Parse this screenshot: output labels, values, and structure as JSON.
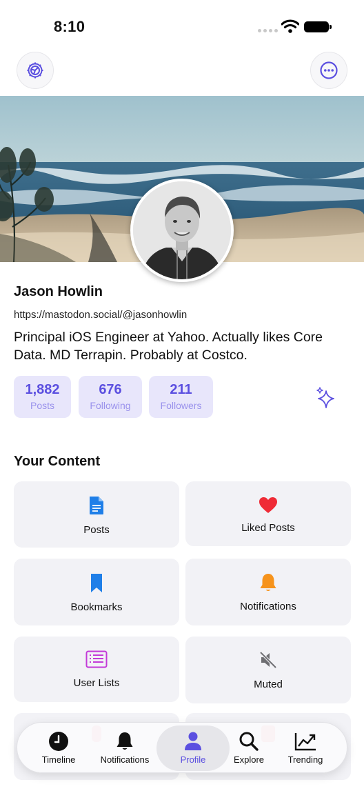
{
  "status": {
    "time": "8:10"
  },
  "profile": {
    "name": "Jason Howlin",
    "handle": "https://mastodon.social/@jasonhowlin",
    "bio": "Principal iOS Engineer at Yahoo. Actually likes Core Data. MD Terrapin. Probably at Costco."
  },
  "stats": [
    {
      "value": "1,882",
      "label": "Posts"
    },
    {
      "value": "676",
      "label": "Following"
    },
    {
      "value": "211",
      "label": "Followers"
    }
  ],
  "content": {
    "title": "Your Content",
    "tiles": [
      {
        "label": "Posts",
        "icon": "document-icon"
      },
      {
        "label": "Liked Posts",
        "icon": "heart-icon"
      },
      {
        "label": "Bookmarks",
        "icon": "bookmark-icon"
      },
      {
        "label": "Notifications",
        "icon": "bell-icon"
      },
      {
        "label": "User Lists",
        "icon": "list-icon"
      },
      {
        "label": "Muted",
        "icon": "speaker-mute-icon"
      }
    ]
  },
  "tabbar": {
    "items": [
      {
        "label": "Timeline",
        "icon": "clock-icon"
      },
      {
        "label": "Notifications",
        "icon": "bell-icon"
      },
      {
        "label": "Profile",
        "icon": "person-icon"
      },
      {
        "label": "Explore",
        "icon": "magnifier-icon"
      },
      {
        "label": "Trending",
        "icon": "chart-icon"
      }
    ],
    "active": "Profile"
  },
  "colors": {
    "accent": "#5b4fe0",
    "stat_bg": "#e8e6fb",
    "tile_bg": "#f2f2f6",
    "doc_blue": "#1f7fe8",
    "heart_red": "#ef2b36",
    "bell_orange": "#f6931c",
    "list_purple": "#c33ad8"
  }
}
